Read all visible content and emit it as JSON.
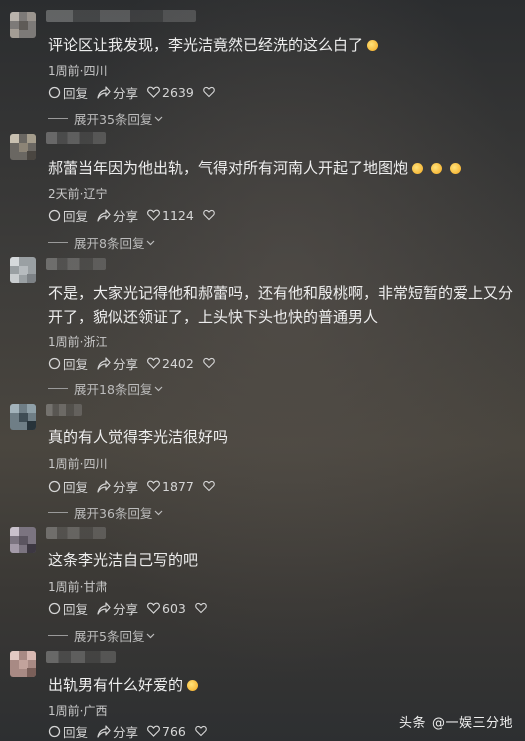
{
  "comments": [
    {
      "text": "评论区让我发现，李光洁竟然已经洗的这么白了",
      "emojis": 1,
      "meta": "1周前·四川",
      "reply_label": "回复",
      "share_label": "分享",
      "likes": "2639",
      "expand": "展开35条回复"
    },
    {
      "text": "郝蕾当年因为他出轨，气得对所有河南人开起了地图炮",
      "emojis": 3,
      "meta": "2天前·辽宁",
      "reply_label": "回复",
      "share_label": "分享",
      "likes": "1124",
      "expand": "展开8条回复"
    },
    {
      "text": "不是，大家光记得他和郝蕾吗，还有他和殷桃啊，非常短暂的爱上又分开了，貌似还领证了，上头快下头也快的普通男人",
      "emojis": 0,
      "meta": "1周前·浙江",
      "reply_label": "回复",
      "share_label": "分享",
      "likes": "2402",
      "expand": "展开18条回复"
    },
    {
      "text": "真的有人觉得李光洁很好吗",
      "emojis": 0,
      "meta": "1周前·四川",
      "reply_label": "回复",
      "share_label": "分享",
      "likes": "1877",
      "expand": "展开36条回复"
    },
    {
      "text": "这条李光洁自己写的吧",
      "emojis": 0,
      "meta": "1周前·甘肃",
      "reply_label": "回复",
      "share_label": "分享",
      "likes": "603",
      "expand": "展开5条回复"
    },
    {
      "text": "出轨男有什么好爱的",
      "emojis": 1,
      "meta": "1周前·广西",
      "reply_label": "回复",
      "share_label": "分享",
      "likes": "766",
      "expand": ""
    }
  ],
  "watermark": {
    "brand": "头条",
    "author": "@一娱三分地"
  },
  "icons": {
    "reply": "comment-bubble-icon",
    "share": "share-arrow-icon",
    "like": "heart-icon",
    "favorite": "heart-outline-icon",
    "expand": "chevron-down-icon"
  },
  "colors": {
    "text": "#eeeeee",
    "meta": "#c9c9c9",
    "emoji": "#f6b93b"
  }
}
